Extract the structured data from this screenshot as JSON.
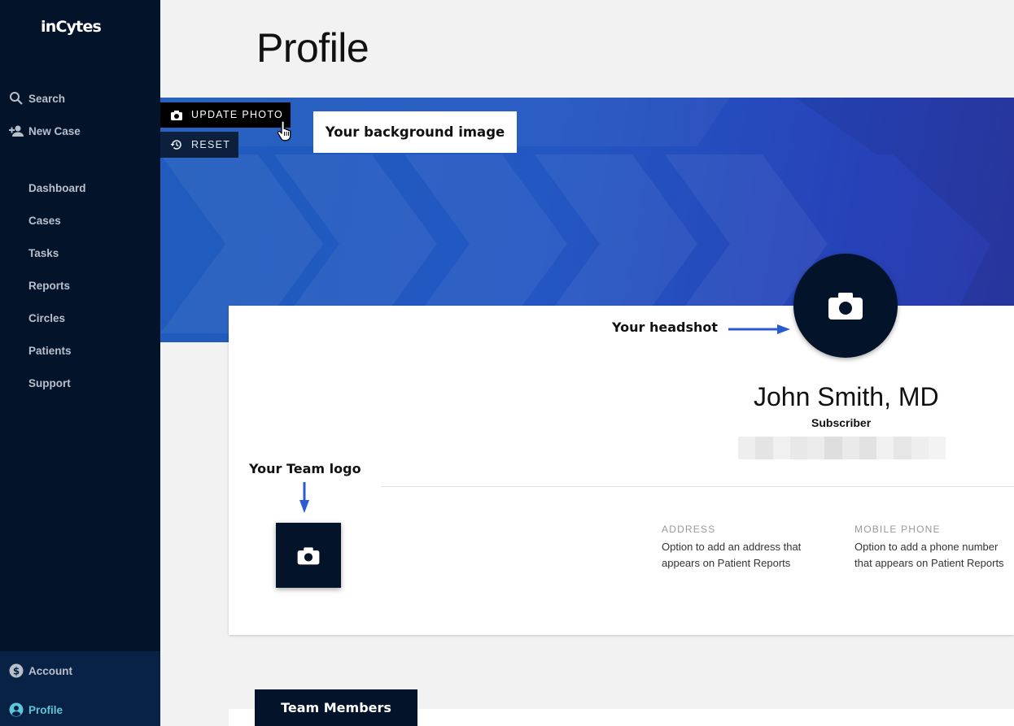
{
  "app": {
    "logo": "inCytes"
  },
  "sidebar": {
    "top_items": [
      {
        "label": "Search",
        "icon": "search-icon"
      },
      {
        "label": "New Case",
        "icon": "add-person-icon"
      }
    ],
    "nav_items": [
      {
        "label": "Dashboard"
      },
      {
        "label": "Cases"
      },
      {
        "label": "Tasks"
      },
      {
        "label": "Reports"
      },
      {
        "label": "Circles"
      },
      {
        "label": "Patients"
      },
      {
        "label": "Support"
      }
    ],
    "bottom_items": [
      {
        "label": "Account",
        "icon": "dollar-icon"
      },
      {
        "label": "Profile",
        "icon": "user-icon",
        "active": true
      }
    ]
  },
  "page": {
    "title": "Profile"
  },
  "banner": {
    "update_photo_label": "UPDATE PHOTO",
    "reset_label": "RESET",
    "callout": "Your background image"
  },
  "profile": {
    "headshot_callout": "Your headshot",
    "name": "John Smith, MD",
    "role": "Subscriber",
    "team_logo_callout": "Your Team logo",
    "address_label": "ADDRESS",
    "address_value": "Option to add an address that appears on Patient Reports",
    "phone_label": "MOBILE PHONE",
    "phone_value": "Option to add a phone number that appears on Patient Reports"
  },
  "team": {
    "tab_label": "Team Members"
  },
  "colors": {
    "sidebar": "#03132a",
    "accent": "#5fc6d8",
    "banner": "#2357c2",
    "arrow": "#2a5bd0"
  }
}
